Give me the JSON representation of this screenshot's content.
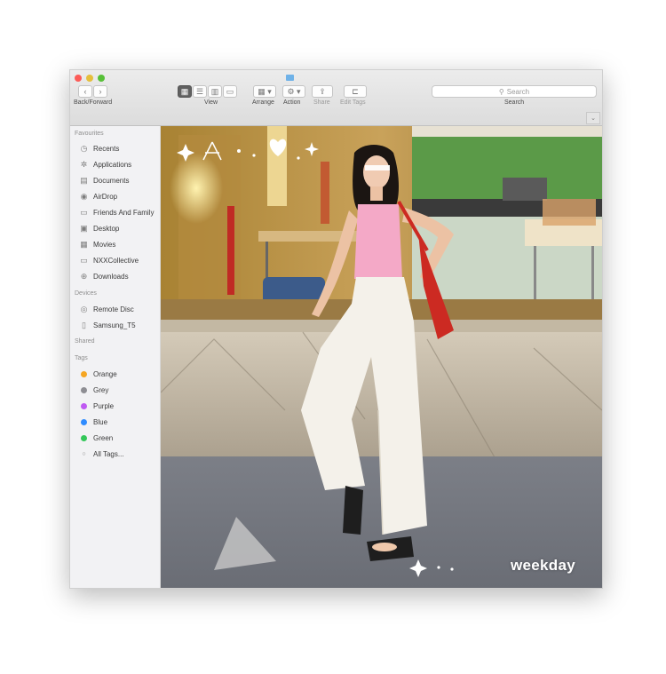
{
  "toolbar": {
    "back_forward_label": "Back/Forward",
    "view_label": "View",
    "arrange_label": "Arrange",
    "action_label": "Action",
    "share_label": "Share",
    "edit_tags_label": "Edit Tags",
    "search_placeholder": "Search",
    "search_label": "Search"
  },
  "sidebar": {
    "favourites_title": "Favourites",
    "favourites": [
      {
        "label": "Recents",
        "icon": "clock-icon"
      },
      {
        "label": "Applications",
        "icon": "applications-icon"
      },
      {
        "label": "Documents",
        "icon": "document-icon"
      },
      {
        "label": "AirDrop",
        "icon": "airdrop-icon"
      },
      {
        "label": "Friends And Family",
        "icon": "folder-icon"
      },
      {
        "label": "Desktop",
        "icon": "desktop-icon"
      },
      {
        "label": "Movies",
        "icon": "film-icon"
      },
      {
        "label": "NXXCollective",
        "icon": "folder-icon"
      },
      {
        "label": "Downloads",
        "icon": "download-icon"
      }
    ],
    "devices_title": "Devices",
    "devices": [
      {
        "label": "Remote Disc",
        "icon": "disc-icon"
      },
      {
        "label": "Samsung_T5",
        "icon": "drive-icon"
      }
    ],
    "shared_title": "Shared",
    "tags_title": "Tags",
    "tags": [
      {
        "label": "Orange",
        "color": "#f5a623"
      },
      {
        "label": "Grey",
        "color": "#8e8e93"
      },
      {
        "label": "Purple",
        "color": "#bf5af2"
      },
      {
        "label": "Blue",
        "color": "#2f8cff"
      },
      {
        "label": "Green",
        "color": "#34c759"
      }
    ],
    "all_tags": "All Tags..."
  },
  "photo": {
    "brand_text": "weekday"
  }
}
